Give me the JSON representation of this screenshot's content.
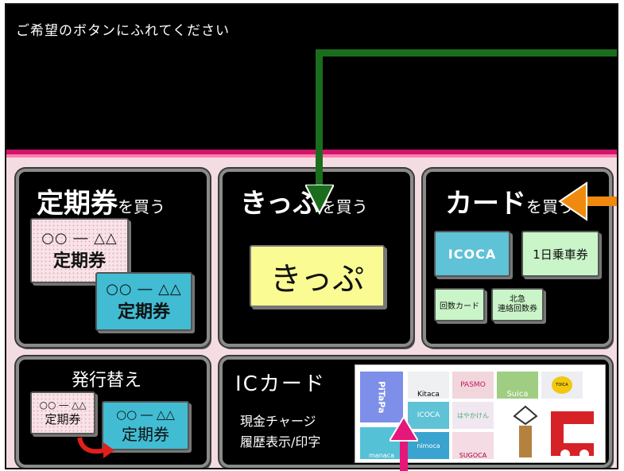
{
  "prompt": "ご希望のボタンにふれてください",
  "teiki": {
    "title": "定期券",
    "suffix": "を買う",
    "card1_route": "○○ ― △△",
    "card1_name": "定期券",
    "card2_route": "○○ ― △△",
    "card2_name": "定期券"
  },
  "kippu": {
    "title": "きっぷ",
    "suffix": "を買う",
    "card_label": "きっぷ"
  },
  "card_buy": {
    "title": "カード",
    "suffix": "を買う",
    "icoca": "ICOCA",
    "one_day": "1日乗車券",
    "kaisu": "回数カード",
    "hokkyu_line1": "北急",
    "hokkyu_line2": "連絡回数券"
  },
  "reissue": {
    "title": "発行替え",
    "card1_route": "○○ ― △△",
    "card1_name": "定期券",
    "card2_route": "○○ ― △△",
    "card2_name": "定期券"
  },
  "ic": {
    "title": "ICカード",
    "line1": "現金チャージ",
    "line2": "履歴表示/印字",
    "logos": {
      "pitapa": "PiTaPa",
      "kitaca": "Kitaca",
      "pasmo": "PASMO",
      "suica": "Suica",
      "toica": "TOICA",
      "icoca": "ICOCA",
      "nimoca": "nimoca",
      "hayakaken": "はやかけん",
      "sugoca": "SUGOCA",
      "manaca": "manaca"
    }
  },
  "colors": {
    "green_arrow": "#1b6d1e",
    "orange_arrow": "#f08a0e",
    "pink_arrow": "#e5177a",
    "panel": "#f4dde2",
    "accent_band": "#d0166a"
  }
}
